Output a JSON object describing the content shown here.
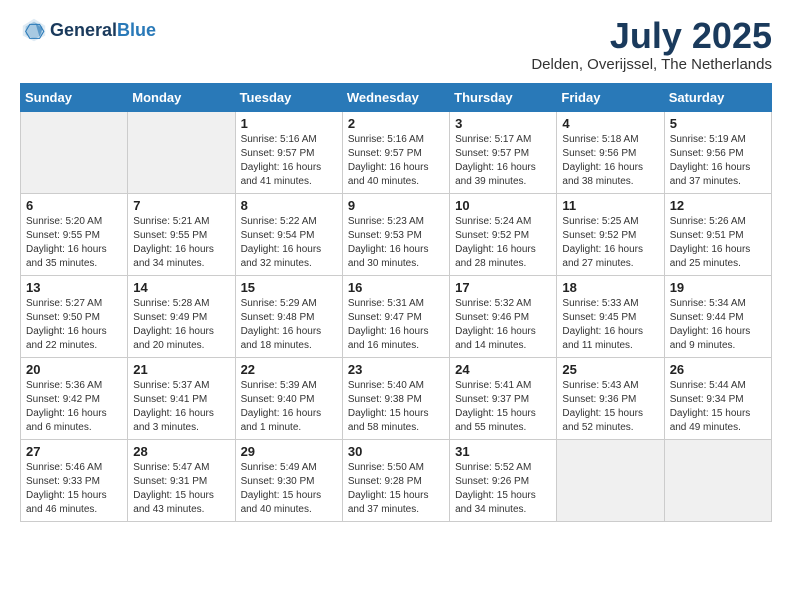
{
  "header": {
    "logo_general": "General",
    "logo_blue": "Blue",
    "month_title": "July 2025",
    "location": "Delden, Overijssel, The Netherlands"
  },
  "days_of_week": [
    "Sunday",
    "Monday",
    "Tuesday",
    "Wednesday",
    "Thursday",
    "Friday",
    "Saturday"
  ],
  "weeks": [
    [
      {
        "day": "",
        "info": ""
      },
      {
        "day": "",
        "info": ""
      },
      {
        "day": "1",
        "info": "Sunrise: 5:16 AM\nSunset: 9:57 PM\nDaylight: 16 hours and 41 minutes."
      },
      {
        "day": "2",
        "info": "Sunrise: 5:16 AM\nSunset: 9:57 PM\nDaylight: 16 hours and 40 minutes."
      },
      {
        "day": "3",
        "info": "Sunrise: 5:17 AM\nSunset: 9:57 PM\nDaylight: 16 hours and 39 minutes."
      },
      {
        "day": "4",
        "info": "Sunrise: 5:18 AM\nSunset: 9:56 PM\nDaylight: 16 hours and 38 minutes."
      },
      {
        "day": "5",
        "info": "Sunrise: 5:19 AM\nSunset: 9:56 PM\nDaylight: 16 hours and 37 minutes."
      }
    ],
    [
      {
        "day": "6",
        "info": "Sunrise: 5:20 AM\nSunset: 9:55 PM\nDaylight: 16 hours and 35 minutes."
      },
      {
        "day": "7",
        "info": "Sunrise: 5:21 AM\nSunset: 9:55 PM\nDaylight: 16 hours and 34 minutes."
      },
      {
        "day": "8",
        "info": "Sunrise: 5:22 AM\nSunset: 9:54 PM\nDaylight: 16 hours and 32 minutes."
      },
      {
        "day": "9",
        "info": "Sunrise: 5:23 AM\nSunset: 9:53 PM\nDaylight: 16 hours and 30 minutes."
      },
      {
        "day": "10",
        "info": "Sunrise: 5:24 AM\nSunset: 9:52 PM\nDaylight: 16 hours and 28 minutes."
      },
      {
        "day": "11",
        "info": "Sunrise: 5:25 AM\nSunset: 9:52 PM\nDaylight: 16 hours and 27 minutes."
      },
      {
        "day": "12",
        "info": "Sunrise: 5:26 AM\nSunset: 9:51 PM\nDaylight: 16 hours and 25 minutes."
      }
    ],
    [
      {
        "day": "13",
        "info": "Sunrise: 5:27 AM\nSunset: 9:50 PM\nDaylight: 16 hours and 22 minutes."
      },
      {
        "day": "14",
        "info": "Sunrise: 5:28 AM\nSunset: 9:49 PM\nDaylight: 16 hours and 20 minutes."
      },
      {
        "day": "15",
        "info": "Sunrise: 5:29 AM\nSunset: 9:48 PM\nDaylight: 16 hours and 18 minutes."
      },
      {
        "day": "16",
        "info": "Sunrise: 5:31 AM\nSunset: 9:47 PM\nDaylight: 16 hours and 16 minutes."
      },
      {
        "day": "17",
        "info": "Sunrise: 5:32 AM\nSunset: 9:46 PM\nDaylight: 16 hours and 14 minutes."
      },
      {
        "day": "18",
        "info": "Sunrise: 5:33 AM\nSunset: 9:45 PM\nDaylight: 16 hours and 11 minutes."
      },
      {
        "day": "19",
        "info": "Sunrise: 5:34 AM\nSunset: 9:44 PM\nDaylight: 16 hours and 9 minutes."
      }
    ],
    [
      {
        "day": "20",
        "info": "Sunrise: 5:36 AM\nSunset: 9:42 PM\nDaylight: 16 hours and 6 minutes."
      },
      {
        "day": "21",
        "info": "Sunrise: 5:37 AM\nSunset: 9:41 PM\nDaylight: 16 hours and 3 minutes."
      },
      {
        "day": "22",
        "info": "Sunrise: 5:39 AM\nSunset: 9:40 PM\nDaylight: 16 hours and 1 minute."
      },
      {
        "day": "23",
        "info": "Sunrise: 5:40 AM\nSunset: 9:38 PM\nDaylight: 15 hours and 58 minutes."
      },
      {
        "day": "24",
        "info": "Sunrise: 5:41 AM\nSunset: 9:37 PM\nDaylight: 15 hours and 55 minutes."
      },
      {
        "day": "25",
        "info": "Sunrise: 5:43 AM\nSunset: 9:36 PM\nDaylight: 15 hours and 52 minutes."
      },
      {
        "day": "26",
        "info": "Sunrise: 5:44 AM\nSunset: 9:34 PM\nDaylight: 15 hours and 49 minutes."
      }
    ],
    [
      {
        "day": "27",
        "info": "Sunrise: 5:46 AM\nSunset: 9:33 PM\nDaylight: 15 hours and 46 minutes."
      },
      {
        "day": "28",
        "info": "Sunrise: 5:47 AM\nSunset: 9:31 PM\nDaylight: 15 hours and 43 minutes."
      },
      {
        "day": "29",
        "info": "Sunrise: 5:49 AM\nSunset: 9:30 PM\nDaylight: 15 hours and 40 minutes."
      },
      {
        "day": "30",
        "info": "Sunrise: 5:50 AM\nSunset: 9:28 PM\nDaylight: 15 hours and 37 minutes."
      },
      {
        "day": "31",
        "info": "Sunrise: 5:52 AM\nSunset: 9:26 PM\nDaylight: 15 hours and 34 minutes."
      },
      {
        "day": "",
        "info": ""
      },
      {
        "day": "",
        "info": ""
      }
    ]
  ]
}
